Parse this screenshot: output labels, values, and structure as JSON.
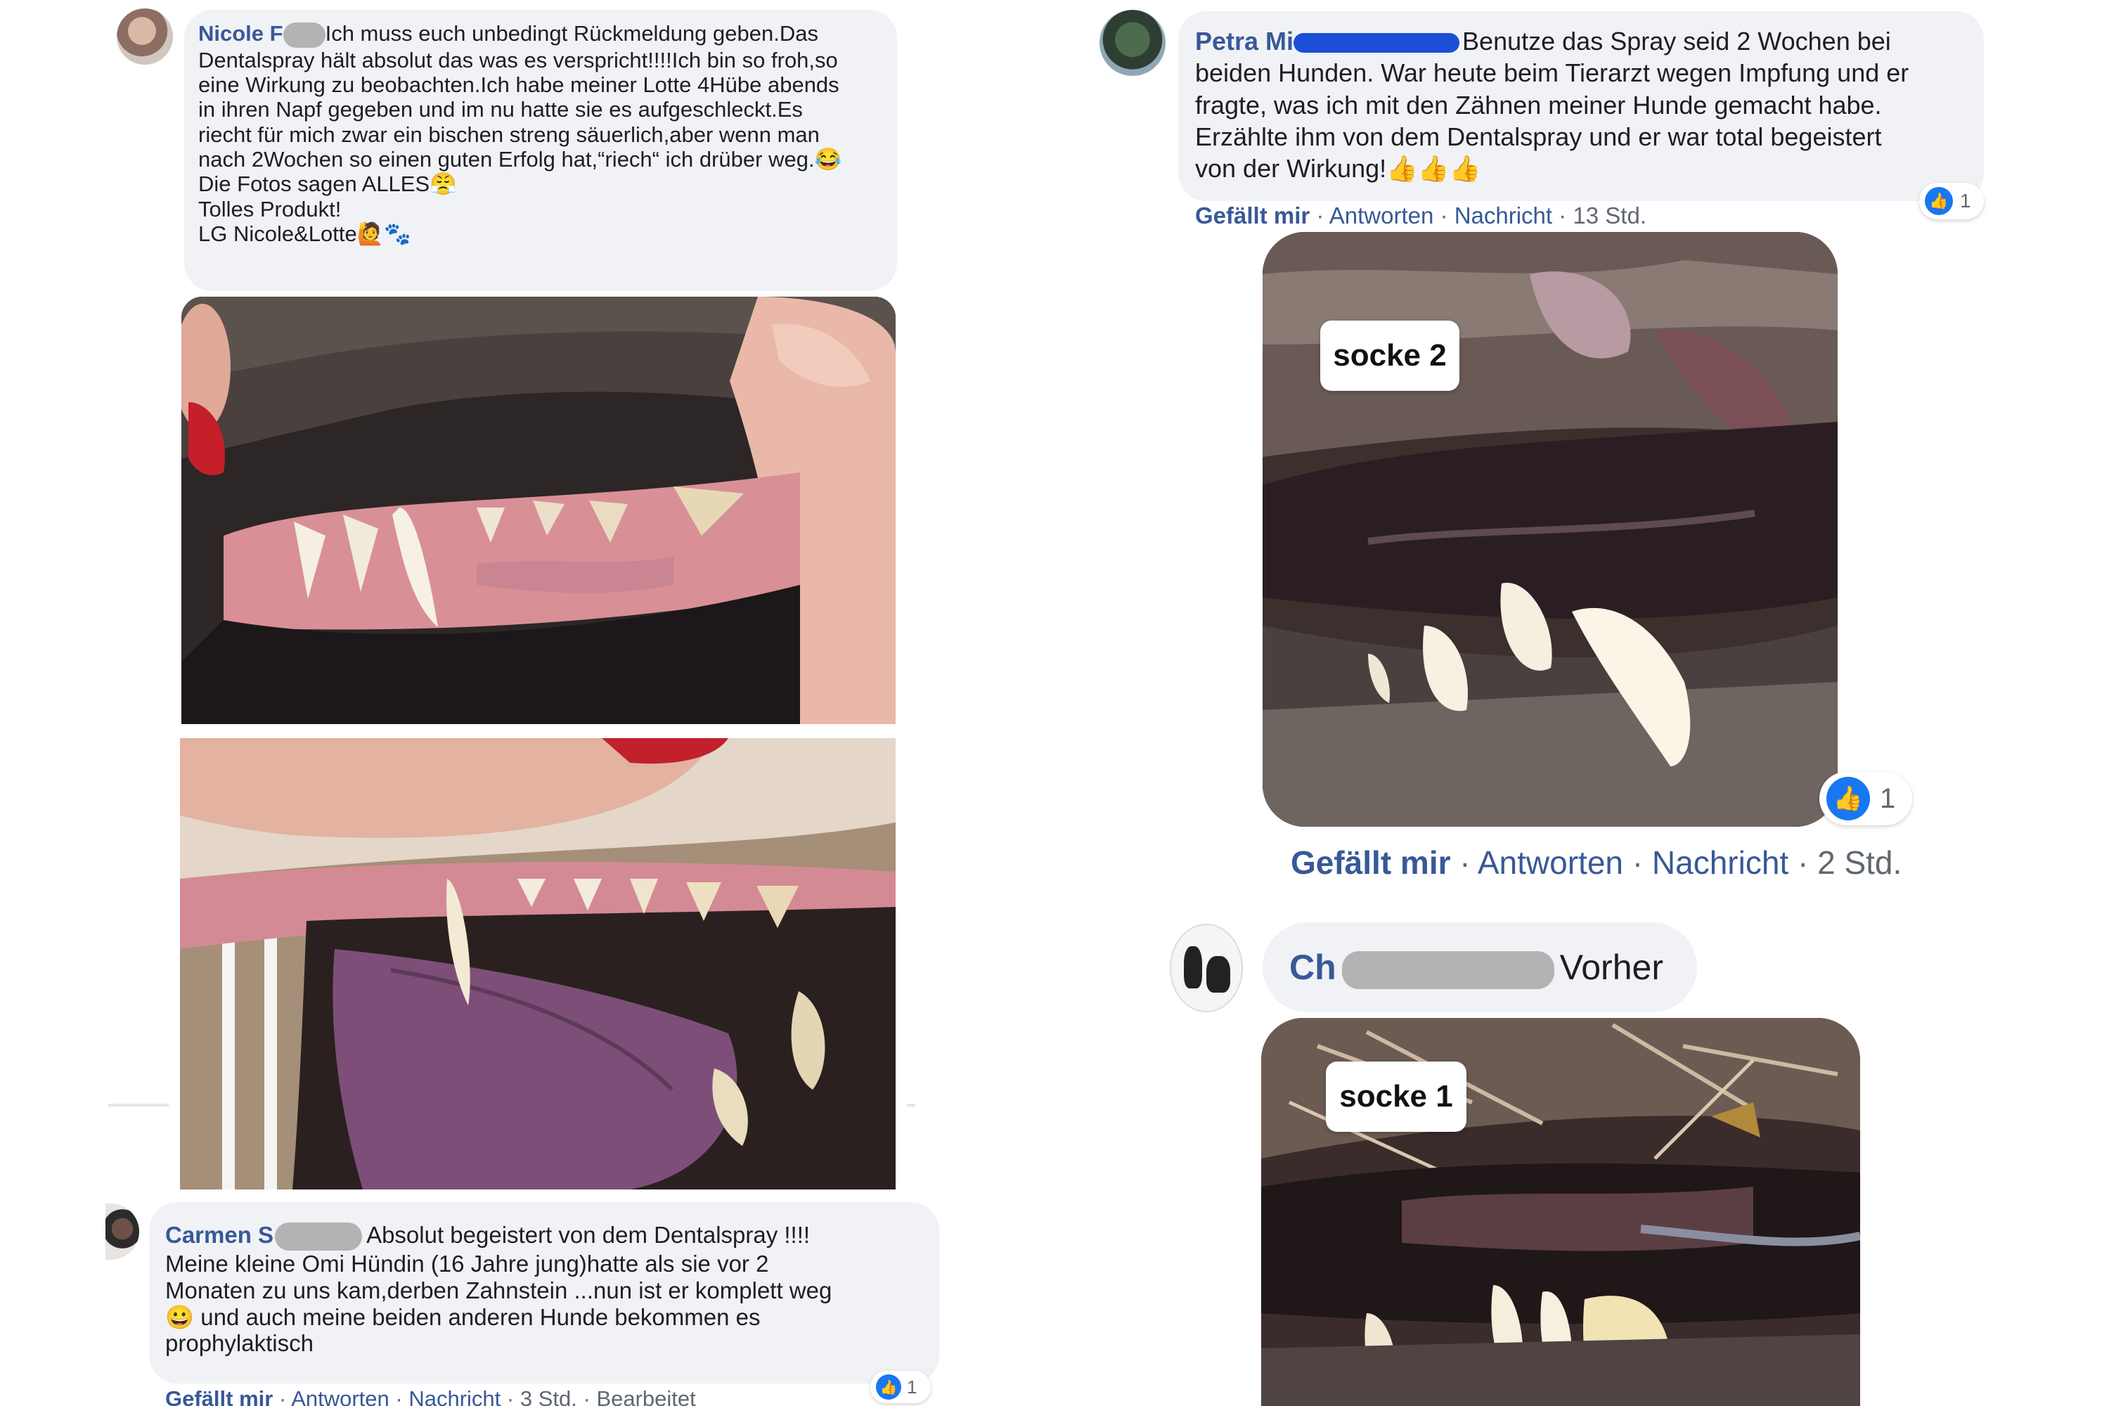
{
  "comment1": {
    "name": "Nicole F",
    "lines": [
      "Ich muss euch unbedingt Rückmeldung geben.Das",
      "Dentalspray hält absolut das was es verspricht!!!!Ich bin so froh,so",
      "eine Wirkung zu beobachten.Ich habe meiner Lotte 4Hübe abends",
      "in ihren Napf gegeben und im nu hatte sie es aufgeschleckt.Es",
      "riecht für mich zwar ein bischen streng säuerlich,aber wenn man",
      "nach 2Wochen so einen guten Erfolg hat,“riech“ ich drüber weg.😂",
      "Die Fotos sagen ALLES😤",
      "Tolles Produkt!",
      "LG Nicole&Lotte🙋🐾"
    ]
  },
  "comment2": {
    "name": "Carmen S",
    "lines": [
      "Absolut begeistert von dem Dentalspray !!!!",
      "Meine kleine Omi Hündin (16 Jahre jung)hatte als sie vor 2",
      "Monaten zu uns kam,derben Zahnstein ...nun ist er komplett weg",
      "😀 und auch meine beiden anderen Hunde bekommen es",
      "prophylaktisch"
    ],
    "meta": {
      "like": "Gefällt mir",
      "reply": "Antworten",
      "message": "Nachricht",
      "time": "3 Std.",
      "edited": "Bearbeitet"
    },
    "reactions": "1"
  },
  "comment3": {
    "name": "Petra Mi",
    "lines": [
      "Benutze das Spray seid 2 Wochen bei",
      "beiden Hunden. War heute beim Tierarzt wegen Impfung und er",
      "fragte, was ich mit den Zähnen meiner Hunde gemacht habe.",
      "Erzählte ihm von dem Dentalspray und er war total begeistert",
      "von der Wirkung!👍👍👍"
    ],
    "meta": {
      "like": "Gefällt mir",
      "reply": "Antworten",
      "message": "Nachricht",
      "time": "13 Std."
    },
    "reactions": "1"
  },
  "photo_socke2": {
    "label": "socke 2",
    "reactions": "1",
    "meta": {
      "like": "Gefällt mir",
      "reply": "Antworten",
      "message": "Nachricht",
      "time": "2 Std."
    }
  },
  "comment4": {
    "name": "Ch",
    "text": "Vorher"
  },
  "photo_socke1": {
    "label": "socke 1"
  },
  "separator": "·",
  "colors": {
    "link": "#385898",
    "bubble": "#f0f2f5",
    "like_blue": "#1877f2",
    "meta_gray": "#606770"
  },
  "icons": {
    "reaction": "thumbs-up-icon"
  }
}
